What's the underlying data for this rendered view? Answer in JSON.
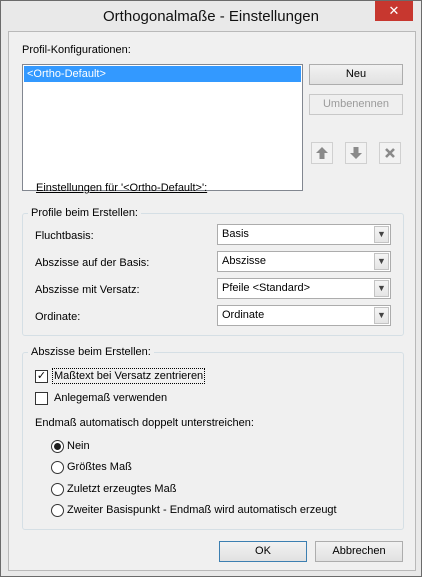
{
  "window": {
    "title": "Orthogonalmaße - Einstellungen",
    "close_glyph": "✕"
  },
  "profiles": {
    "label": "Profil-Konfigurationen:",
    "items": [
      "<Ortho-Default>"
    ],
    "selected_index": 0,
    "new_button": "Neu",
    "rename_button": "Umbenennen",
    "move_up_icon": "arrow-up-icon",
    "move_down_icon": "arrow-down-icon",
    "delete_icon": "delete-x-icon"
  },
  "settings_link": "Einstellungen für '<Ortho-Default>':",
  "create_group": {
    "title": "Profile beim Erstellen:",
    "rows": [
      {
        "label": "Fluchtbasis:",
        "value": "Basis"
      },
      {
        "label": "Abszisse auf der Basis:",
        "value": "Abszisse"
      },
      {
        "label": "Abszisse mit Versatz:",
        "value": "Pfeile <Standard>"
      },
      {
        "label": "Ordinate:",
        "value": "Ordinate"
      }
    ]
  },
  "abscissa_group": {
    "title": "Abszisse beim Erstellen:",
    "center_text_checkbox": {
      "label": "Maßtext bei Versatz zentrieren",
      "checked": true
    },
    "lay_dimension_checkbox": {
      "label": "Anlegemaß verwenden",
      "checked": false
    },
    "double_underline_label": "Endmaß automatisch doppelt unterstreichen:",
    "radio_options": [
      {
        "label": "Nein",
        "checked": true
      },
      {
        "label": "Größtes Maß",
        "checked": false
      },
      {
        "label": "Zuletzt erzeugtes Maß",
        "checked": false
      },
      {
        "label": "Zweiter Basispunkt - Endmaß wird automatisch erzeugt",
        "checked": false
      }
    ]
  },
  "footer": {
    "ok_button": "OK",
    "cancel_button": "Abbrechen"
  },
  "colors": {
    "selection": "#3399ff",
    "close_button": "#c7372f"
  }
}
